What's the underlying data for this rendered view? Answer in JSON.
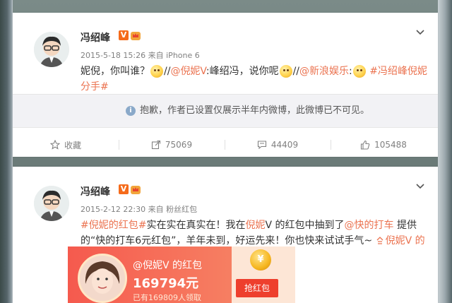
{
  "posts": [
    {
      "author": "冯绍峰",
      "verified_badge": "V",
      "time": "2015-5-18 15:26",
      "source_prefix": "来自",
      "source": "iPhone 6",
      "text_parts": {
        "a": "妮倪，你叫谁？",
        "b": "//",
        "c": "@倪妮V",
        "d": ":峰绍冯，说你呢",
        "e": "//",
        "f": "@新浪娱乐",
        "g": ":",
        "h": "#冯绍峰倪妮分手#"
      },
      "notice": "抱歉，作者已设置仅展示半年内微博，此微博已不可见。",
      "actions": {
        "favorite": "收藏",
        "forward": "75069",
        "comment": "44409",
        "like": "105488"
      }
    },
    {
      "author": "冯绍峰",
      "verified_badge": "V",
      "time": "2015-2-12 22:30",
      "source_prefix": "来自",
      "source": "粉丝红包",
      "text_parts": {
        "a": "#倪妮的红包#",
        "b": "实在实在真实在！我在",
        "c": "倪妮",
        "d": "V 的红包中抽到了",
        "e": "@快的打车",
        "f": " 提供的“快的打车6元红包”，羊年未到，好运先来！你也快来试试手气~ ",
        "g": "倪妮V 的红包"
      },
      "redpacket": {
        "title": "@倪妮V 的红包",
        "amount": "169794元",
        "count": "已有169809人领取",
        "button": "抢红包",
        "coin": "¥"
      }
    }
  ],
  "colors": {
    "link": "#eb7350",
    "verified": "#f56b1b",
    "meta": "#808080"
  },
  "icons": {
    "more": "chevron-down-icon",
    "favorite": "star-icon",
    "forward": "forward-icon",
    "comment": "comment-icon",
    "like": "thumbs-up-icon",
    "notice": "info-icon"
  }
}
